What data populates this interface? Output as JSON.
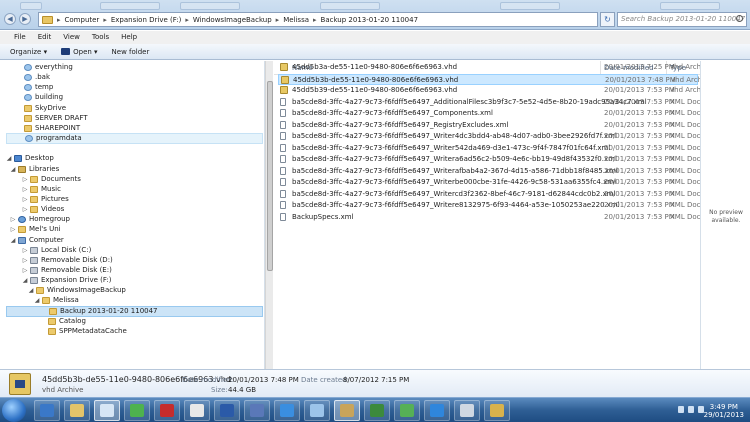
{
  "address": {
    "segments": [
      "Computer",
      "Expansion Drive (F:)",
      "WindowsImageBackup",
      "Melissa",
      "Backup 2013-01-20 110047"
    ]
  },
  "search": {
    "placeholder": "Search Backup 2013-01-20 110047"
  },
  "menu": [
    "File",
    "Edit",
    "View",
    "Tools",
    "Help"
  ],
  "commands": {
    "organize": "Organize ▾",
    "open": "Open ▾",
    "new_folder": "New folder"
  },
  "nav": [
    {
      "label": "everything",
      "icon": "blue-folder-icon",
      "indent": 18,
      "arrow": ""
    },
    {
      "label": ".bak",
      "icon": "blue-folder-icon",
      "indent": 18,
      "arrow": ""
    },
    {
      "label": "temp",
      "icon": "blue-folder-icon",
      "indent": 18,
      "arrow": ""
    },
    {
      "label": "building",
      "icon": "blue-folder-icon",
      "indent": 18,
      "arrow": ""
    },
    {
      "label": "SkyDrive",
      "icon": "folder-icon",
      "indent": 18,
      "arrow": ""
    },
    {
      "label": "SERVER DRAFT",
      "icon": "folder-icon",
      "indent": 18,
      "arrow": ""
    },
    {
      "label": "SHAREPOINT",
      "icon": "folder-icon",
      "indent": 18,
      "arrow": ""
    },
    {
      "label": "programdata",
      "icon": "blue-folder-icon",
      "indent": 18,
      "arrow": "",
      "state": "hover"
    },
    {
      "label": "",
      "icon": "",
      "indent": 0,
      "arrow": ""
    },
    {
      "label": "Desktop",
      "icon": "desktop-icon",
      "indent": 8,
      "arrow": "◢"
    },
    {
      "label": "Libraries",
      "icon": "library-icon",
      "indent": 12,
      "arrow": "◢"
    },
    {
      "label": "Documents",
      "icon": "folder-icon",
      "indent": 24,
      "arrow": "▷"
    },
    {
      "label": "Music",
      "icon": "folder-icon",
      "indent": 24,
      "arrow": "▷"
    },
    {
      "label": "Pictures",
      "icon": "folder-icon",
      "indent": 24,
      "arrow": "▷"
    },
    {
      "label": "Videos",
      "icon": "folder-icon",
      "indent": 24,
      "arrow": "▷"
    },
    {
      "label": "Homegroup",
      "icon": "network-icon",
      "indent": 12,
      "arrow": "▷"
    },
    {
      "label": "Mel's Uni",
      "icon": "folder-icon",
      "indent": 12,
      "arrow": "▷"
    },
    {
      "label": "Computer",
      "icon": "computer-icon",
      "indent": 12,
      "arrow": "◢"
    },
    {
      "label": "Local Disk (C:)",
      "icon": "drive-icon",
      "indent": 24,
      "arrow": "▷"
    },
    {
      "label": "Removable Disk (D:)",
      "icon": "drive-icon",
      "indent": 24,
      "arrow": "▷"
    },
    {
      "label": "Removable Disk (E:)",
      "icon": "drive-icon",
      "indent": 24,
      "arrow": "▷"
    },
    {
      "label": "Expansion Drive (F:)",
      "icon": "drive-icon",
      "indent": 24,
      "arrow": "◢"
    },
    {
      "label": "WindowsImageBackup",
      "icon": "folder-icon",
      "indent": 30,
      "arrow": "◢"
    },
    {
      "label": "Melissa",
      "icon": "folder-icon",
      "indent": 36,
      "arrow": "◢"
    },
    {
      "label": "Backup 2013-01-20 110047",
      "icon": "folder-icon",
      "indent": 42,
      "arrow": "",
      "state": "sel"
    },
    {
      "label": "Catalog",
      "icon": "folder-icon",
      "indent": 42,
      "arrow": ""
    },
    {
      "label": "SPPMetadataCache",
      "icon": "folder-icon",
      "indent": 42,
      "arrow": ""
    }
  ],
  "columns": {
    "name": "Name",
    "date": "Date modified",
    "type": "Type"
  },
  "files": [
    {
      "name": "45dd5b3a-de55-11e0-9480-806e6f6e6963.vhd",
      "date": "20/01/2013 7:25 PM",
      "type": "vhd Archi",
      "icon": "vhd-icon"
    },
    {
      "name": "45dd5b3b-de55-11e0-9480-806e6f6e6963.vhd",
      "date": "20/01/2013 7:48 PM",
      "type": "vhd Archi",
      "icon": "vhd-icon",
      "selected": true
    },
    {
      "name": "45dd5b39-de55-11e0-9480-806e6f6e6963.vhd",
      "date": "20/01/2013 7:53 PM",
      "type": "vhd Archi",
      "icon": "vhd-icon"
    },
    {
      "name": "ba5cde8d-3ffc-4a27-9c73-f6fdff5e6497_AdditionalFilesc3b9f3c7-5e52-4d5e-8b20-19adc95a34c7.xml",
      "date": "20/01/2013 7:53 PM",
      "type": "XML Doc",
      "icon": "xml-icon"
    },
    {
      "name": "ba5cde8d-3ffc-4a27-9c73-f6fdff5e6497_Components.xml",
      "date": "20/01/2013 7:53 PM",
      "type": "XML Doc",
      "icon": "xml-icon"
    },
    {
      "name": "ba5cde8d-3ffc-4a27-9c73-f6fdff5e6497_RegistryExcludes.xml",
      "date": "20/01/2013 7:53 PM",
      "type": "XML Doc",
      "icon": "xml-icon"
    },
    {
      "name": "ba5cde8d-3ffc-4a27-9c73-f6fdff5e6497_Writer4dc3bdd4-ab48-4d07-adb0-3bee2926fd7f.xml",
      "date": "20/01/2013 7:53 PM",
      "type": "XML Doc",
      "icon": "xml-icon"
    },
    {
      "name": "ba5cde8d-3ffc-4a27-9c73-f6fdff5e6497_Writer542da469-d3e1-473c-9f4f-7847f01fc64f.xml",
      "date": "20/01/2013 7:53 PM",
      "type": "XML Doc",
      "icon": "xml-icon"
    },
    {
      "name": "ba5cde8d-3ffc-4a27-9c73-f6fdff5e6497_Writera6ad56c2-b509-4e6c-bb19-49d8f43532f0.xml",
      "date": "20/01/2013 7:53 PM",
      "type": "XML Doc",
      "icon": "xml-icon"
    },
    {
      "name": "ba5cde8d-3ffc-4a27-9c73-f6fdff5e6497_Writerafbab4a2-367d-4d15-a586-71dbb18f8485.xml",
      "date": "20/01/2013 7:53 PM",
      "type": "XML Doc",
      "icon": "xml-icon"
    },
    {
      "name": "ba5cde8d-3ffc-4a27-9c73-f6fdff5e6497_Writerbe000cbe-31fe-4426-9c58-531aa6355fc4.xml",
      "date": "20/01/2013 7:53 PM",
      "type": "XML Doc",
      "icon": "xml-icon"
    },
    {
      "name": "ba5cde8d-3ffc-4a27-9c73-f6fdff5e6497_Writercd3f2362-8bef-46c7-9181-d62844cdc0b2.xml",
      "date": "20/01/2013 7:53 PM",
      "type": "XML Doc",
      "icon": "xml-icon"
    },
    {
      "name": "ba5cde8d-3ffc-4a27-9c73-f6fdff5e6497_Writere8132975-6f93-4464-a53e-1050253ae220.xml",
      "date": "20/01/2013 7:53 PM",
      "type": "XML Doc",
      "icon": "xml-icon"
    },
    {
      "name": "BackupSpecs.xml",
      "date": "20/01/2013 7:53 PM",
      "type": "XML Doc",
      "icon": "xml-icon"
    }
  ],
  "preview": {
    "text": "No preview available."
  },
  "details": {
    "name": "45dd5b3b-de55-11e0-9480-806e6f6e6963.vhd",
    "kind": "vhd Archive",
    "modified_label": "Date modified:",
    "modified": "20/01/2013 7:48 PM",
    "created_label": "Date created:",
    "created": "8/07/2012 7:15 PM",
    "size_label": "Size:",
    "size": "44.4 GB"
  },
  "taskbar": {
    "apps": [
      {
        "icon": "media-player-icon",
        "color": "#3a78c8"
      },
      {
        "icon": "explorer-folder-icon",
        "color": "#e3c46a"
      },
      {
        "icon": "paint-icon",
        "color": "#d7e6f5"
      },
      {
        "icon": "clock-icon",
        "color": "#4eb24e"
      },
      {
        "icon": "pdf-reader-icon",
        "color": "#c62c2c"
      },
      {
        "icon": "docs-icon",
        "color": "#e8e8e8"
      },
      {
        "icon": "word-icon",
        "color": "#2b5aa8"
      },
      {
        "icon": "viewer-icon",
        "color": "#5a78b8"
      },
      {
        "icon": "mail-icon",
        "color": "#3a8ee0"
      },
      {
        "icon": "window-icon",
        "color": "#9cc4ea"
      },
      {
        "icon": "archive-icon",
        "color": "#c9a45a"
      },
      {
        "icon": "console-icon",
        "color": "#3c8a3c"
      },
      {
        "icon": "timer-icon",
        "color": "#56b056"
      },
      {
        "icon": "browser-icon",
        "color": "#2f86dc"
      },
      {
        "icon": "tool-icon",
        "color": "#d0d8e2"
      },
      {
        "icon": "folder-icon",
        "color": "#d9b24c"
      }
    ],
    "time": "3:49 PM",
    "date": "29/01/2013"
  }
}
